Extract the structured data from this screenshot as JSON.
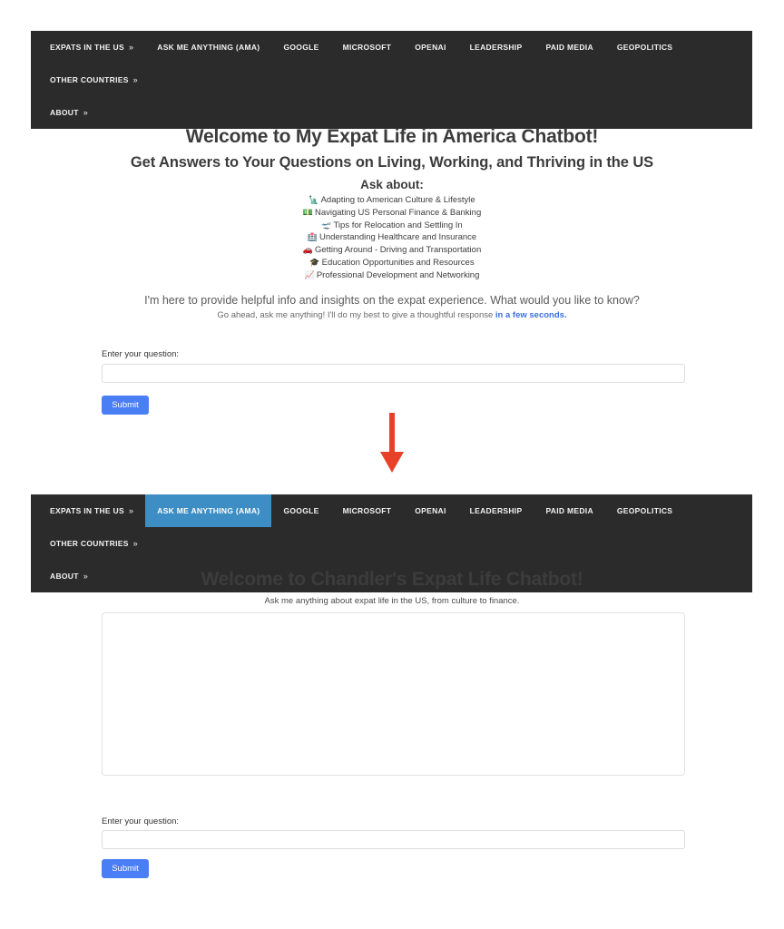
{
  "nav": {
    "items": [
      {
        "label": "Expats in the US",
        "caret": "»",
        "active": false
      },
      {
        "label": "Ask Me Anything (AMA)",
        "caret": "",
        "active": false
      },
      {
        "label": "Google",
        "caret": "",
        "active": false
      },
      {
        "label": "Microsoft",
        "caret": "",
        "active": false
      },
      {
        "label": "OpenAI",
        "caret": "",
        "active": false
      },
      {
        "label": "Leadership",
        "caret": "",
        "active": false
      },
      {
        "label": "Paid Media",
        "caret": "",
        "active": false
      },
      {
        "label": "Geopolitics",
        "caret": "",
        "active": false
      },
      {
        "label": "Other Countries",
        "caret": "»",
        "active": false
      },
      {
        "label": "About",
        "caret": "»",
        "active": false
      }
    ],
    "items_active": [
      {
        "label": "Expats in the US",
        "caret": "»",
        "active": false
      },
      {
        "label": "Ask Me Anything (AMA)",
        "caret": "",
        "active": true
      },
      {
        "label": "Google",
        "caret": "",
        "active": false
      },
      {
        "label": "Microsoft",
        "caret": "",
        "active": false
      },
      {
        "label": "OpenAI",
        "caret": "",
        "active": false
      },
      {
        "label": "Leadership",
        "caret": "",
        "active": false
      },
      {
        "label": "Paid Media",
        "caret": "",
        "active": false
      },
      {
        "label": "Geopolitics",
        "caret": "",
        "active": false
      },
      {
        "label": "Other Countries",
        "caret": "»",
        "active": false
      },
      {
        "label": "About",
        "caret": "»",
        "active": false
      }
    ],
    "active_label": "Ask Me Anything (AMA)",
    "background_color": "#2b2b2b",
    "active_color": "#3d8ec4"
  },
  "top_section": {
    "heading": "Welcome to My Expat Life in America Chatbot!",
    "subheading": "Get Answers to Your Questions on Living, Working, and Thriving in the US",
    "ask_about_label": "Ask about:",
    "ask_about_items": [
      {
        "emoji": "🗽",
        "icon_name": "statue-of-liberty-icon",
        "text": "Adapting to American Culture & Lifestyle"
      },
      {
        "emoji": "💵",
        "icon_name": "banknote-icon",
        "text": "Navigating US Personal Finance & Banking"
      },
      {
        "emoji": "🛫",
        "icon_name": "airplane-departure-icon",
        "text": "Tips for Relocation and Settling In"
      },
      {
        "emoji": "🏥",
        "icon_name": "hospital-icon",
        "text": "Understanding Healthcare and Insurance"
      },
      {
        "emoji": "🚗",
        "icon_name": "car-icon",
        "text": "Getting Around - Driving and Transportation"
      },
      {
        "emoji": "🎓",
        "icon_name": "graduation-cap-icon",
        "text": "Education Opportunities and Resources"
      },
      {
        "emoji": "📈",
        "icon_name": "chart-increasing-icon",
        "text": "Professional Development and Networking"
      }
    ],
    "intro_line_1": "I'm here to provide helpful info and insights on the expat experience. What would you like to know?",
    "intro_line_2_prefix": "Go ahead, ask me anything! I'll do my best to give a thoughtful response ",
    "intro_line_2_highlight": "in a few seconds.",
    "form": {
      "label": "Enter your question:",
      "input_value": "",
      "input_placeholder": "",
      "submit_label": "Submit"
    }
  },
  "arrow": {
    "icon_name": "down-arrow-icon",
    "color": "#e8412a",
    "direction": "down"
  },
  "bottom_section": {
    "heading": "Welcome to Chandler's Expat Life Chatbot!",
    "subheading": "Ask me anything about expat life in the US, from culture to finance.",
    "output_box_text": "",
    "form": {
      "label": "Enter your question:",
      "input_value": "",
      "input_placeholder": "",
      "submit_label": "Submit"
    }
  },
  "colors": {
    "navbar_bg": "#2b2b2b",
    "navbar_active": "#3d8ec4",
    "submit_blue": "#4a7ef5",
    "arrow_red": "#e8412a",
    "link_blue": "#3b6fe0",
    "page_bg": "#ffffff"
  }
}
